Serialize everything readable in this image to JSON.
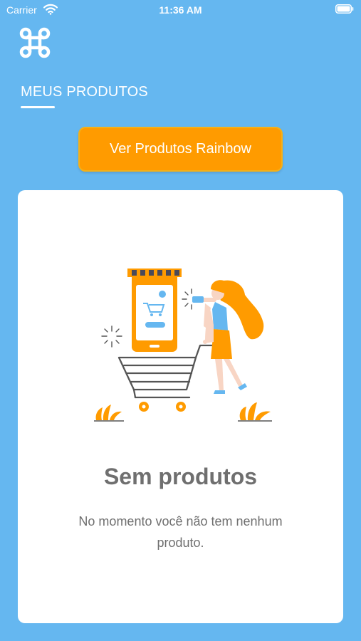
{
  "status_bar": {
    "carrier": "Carrier",
    "time": "11:36 AM"
  },
  "header": {
    "logo_icon": "command-icon",
    "tab_label": "MEUS PRODUTOS"
  },
  "actions": {
    "view_products_label": "Ver Produtos Rainbow"
  },
  "empty_state": {
    "illustration": "shopping-woman-cart-illustration",
    "title": "Sem produtos",
    "description": "No momento você não tem nenhum produto."
  },
  "colors": {
    "background": "#65b7f0",
    "accent": "#ff9b00",
    "card": "#ffffff",
    "text_muted": "#6f6f6f"
  }
}
